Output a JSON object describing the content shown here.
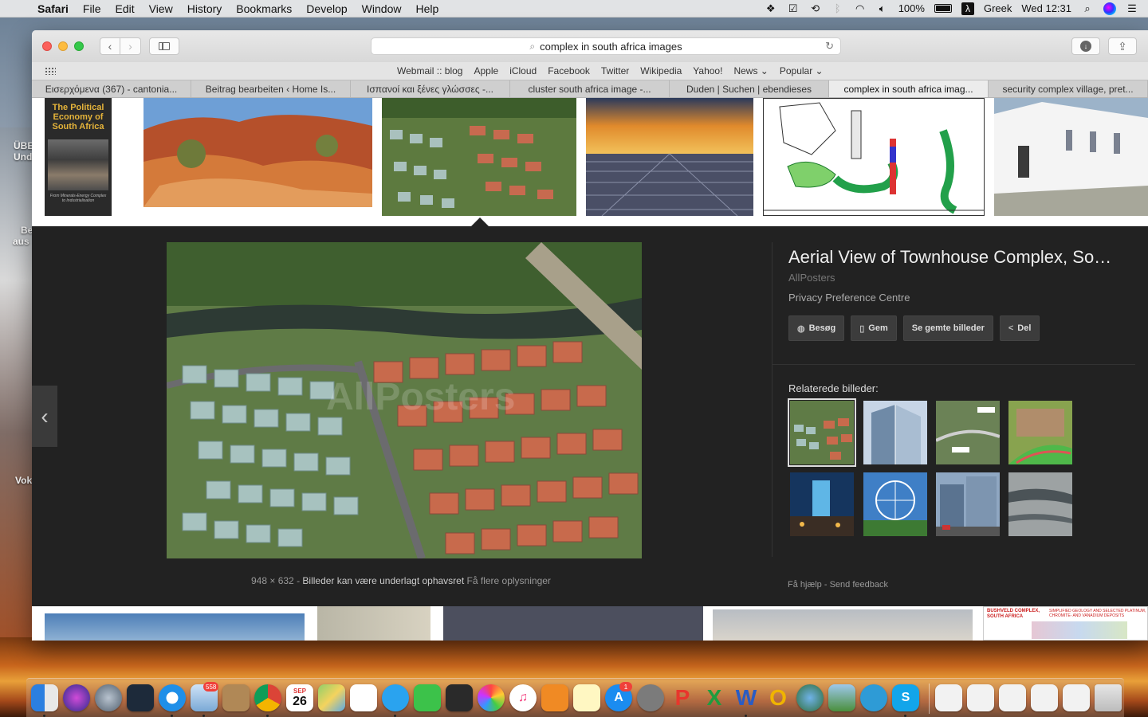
{
  "menubar": {
    "app_name": "Safari",
    "items": [
      "File",
      "Edit",
      "View",
      "History",
      "Bookmarks",
      "Develop",
      "Window",
      "Help"
    ],
    "battery_percent": "100%",
    "input_source": "Greek",
    "clock": "Wed 12:31"
  },
  "desktop": {
    "label1_line1": "ÜBE",
    "label1_line2": "Und",
    "label2_line1": "Be",
    "label2_line2": "aus",
    "label3": "Vok"
  },
  "toolbar": {
    "address": "complex in south africa images"
  },
  "favorites": [
    "Webmail :: blog",
    "Apple",
    "iCloud",
    "Facebook",
    "Twitter",
    "Wikipedia",
    "Yahoo!",
    "News ⌄",
    "Popular ⌄"
  ],
  "tabs": [
    {
      "label": "Εισερχόμενα (367) - cantonia..."
    },
    {
      "label": "Beitrag bearbeiten ‹ Home Is..."
    },
    {
      "label": "Ισπανοί και ξένες γλώσσες -..."
    },
    {
      "label": "cluster south africa image -..."
    },
    {
      "label": "Duden | Suchen | ebendieses"
    },
    {
      "label": "complex in south africa imag..."
    },
    {
      "label": "security complex village, pret..."
    }
  ],
  "thumbnails": {
    "book_title": "The Political Economy of South Africa",
    "book_subtitle": "From Minerals-Energy Complex to Industrialisation"
  },
  "preview": {
    "title": "Aerial View of Townhouse Complex, So…",
    "source": "AllPosters",
    "subtitle": "Privacy Preference Centre",
    "buttons": {
      "visit": "Besøg",
      "save": "Gem",
      "saved_images": "Se gemte billeder",
      "share": "Del"
    },
    "related_title": "Relaterede billeder:",
    "dimensions": "948 × 632",
    "copyright_note": "Billeder kan være underlagt ophavsret",
    "more_info": "Få flere oplysninger",
    "help": "Få hjælp",
    "feedback": "Send feedback",
    "watermark": "AllPosters"
  },
  "bottom_row": {
    "geology_caption_1": "BUSHVELD COMPLEX, SOUTH AFRICA",
    "geology_caption_2": "SIMPLIFIED GEOLOGY AND SELECTED PLATINUM, CHROMITE- AND VANADIUM DEPOSITS"
  },
  "dock": {
    "mail_badge": "558",
    "calendar_month": "SEP",
    "calendar_day": "26",
    "appstore_badge": "1"
  },
  "colors": {
    "panel_bg": "#222222",
    "active_tab": "#ececec"
  }
}
